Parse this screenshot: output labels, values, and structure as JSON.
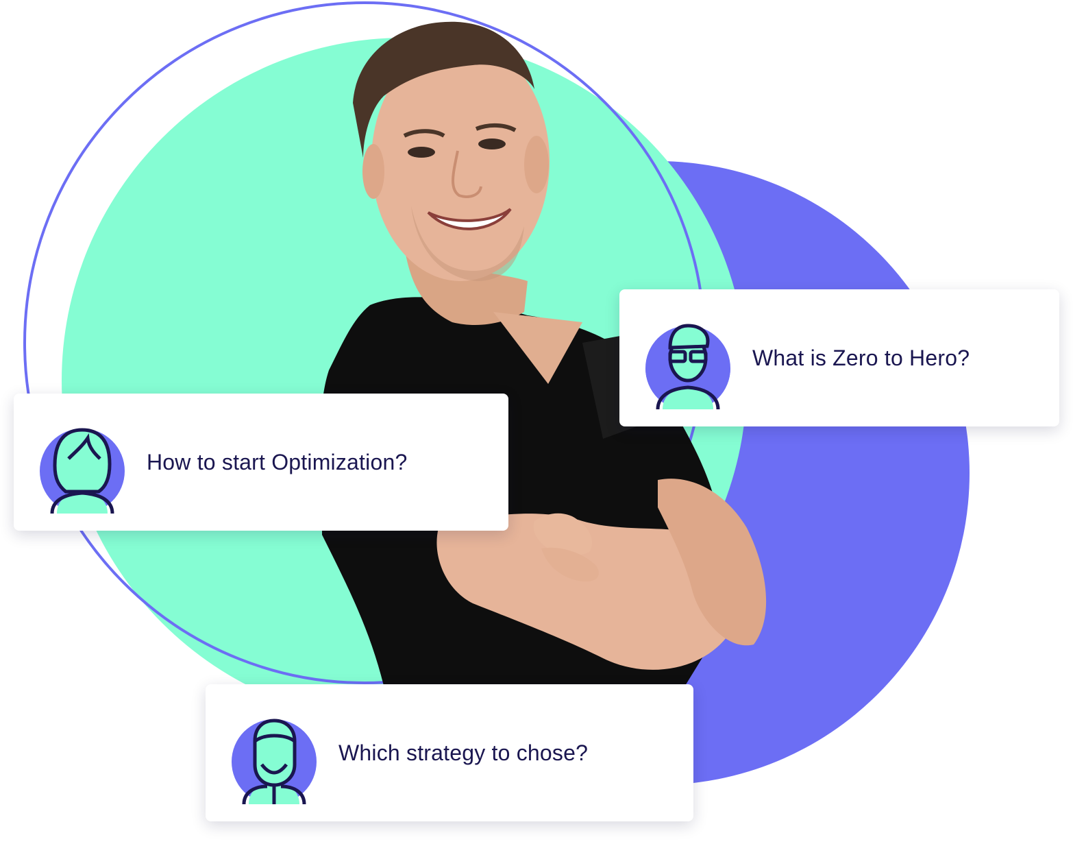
{
  "colors": {
    "mint": "#85FDD3",
    "purple": "#6C6EF4",
    "navy": "#1A1650",
    "shirt": "#0E0E0E",
    "skin": "#E6B499",
    "hair": "#4A3528"
  },
  "cards": {
    "zero_to_hero": {
      "text": "What is Zero to Hero?",
      "avatar_icon": "man-with-glasses-icon"
    },
    "optimization": {
      "text": "How to start Optimization?",
      "avatar_icon": "woman-icon"
    },
    "strategy": {
      "text": "Which strategy to chose?",
      "avatar_icon": "man-with-beard-icon"
    }
  }
}
